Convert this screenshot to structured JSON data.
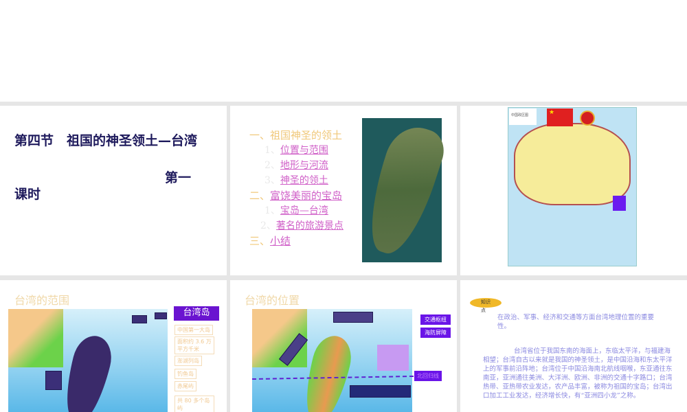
{
  "slides": [
    {
      "title_line1": "第四节　祖国的神圣领土—台湾",
      "title_line2": "第一",
      "title_line3": "课时"
    },
    {
      "toc": [
        {
          "num": "一、",
          "label": "祖国神圣的领土"
        },
        {
          "num": "1、",
          "label": "位置与范围"
        },
        {
          "num": "2、",
          "label": "地形与河流"
        },
        {
          "num": "3、",
          "label": "神圣的领土"
        },
        {
          "num": "二、",
          "label": "富饶美丽的宝岛"
        },
        {
          "num": "1、",
          "label": "宝岛—台湾"
        },
        {
          "num": "2、",
          "label": "著名的旅游景点"
        },
        {
          "num": "三、",
          "label": "小结"
        }
      ]
    },
    {
      "map_label": "中国政区图"
    },
    {
      "title": "台湾的范围",
      "main_tag": "台湾岛",
      "tags": [
        "中国第一大岛",
        "面积约 3.6 万平方千米",
        "澎湖列岛",
        "钓鱼岛",
        "赤尾屿",
        "共 80 多个岛屿"
      ]
    },
    {
      "title": "台湾的位置",
      "tags": [
        "交通枢纽",
        "海防屏障"
      ],
      "line_label": "北回归线"
    },
    {
      "badge": "知识",
      "badge2": "点",
      "point": "在政治、军事、经济和交通等方面台湾地理位置的重要性。",
      "body": "台湾省位于我国东南的海面上，东临太平洋，与福建海相望；台湾自古以来就是我国的神圣领土，是中国沿海和东太平洋上的军事前沿阵地；台湾位于中国沿海南北航线咽喉，东亚通往东南亚，亚洲通往美洲、大洋洲、欧洲、非洲的交通十字路口；台湾热带、亚热带农业发达，农产品丰富，被称为祖国的宝岛；台湾出口加工工业发达，经济增长快，有“亚洲四小龙”之称。"
    }
  ]
}
